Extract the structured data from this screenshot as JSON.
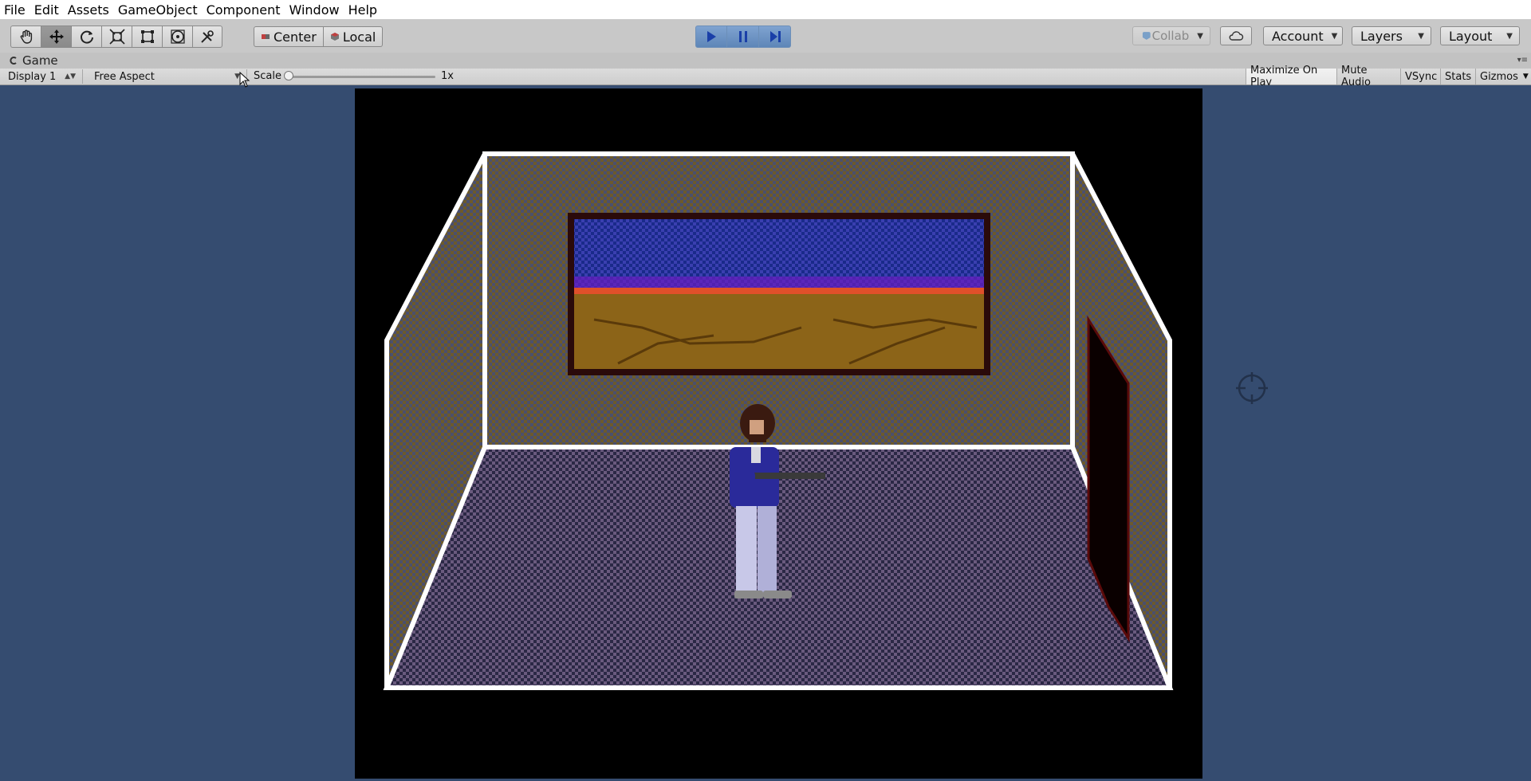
{
  "menu": [
    "File",
    "Edit",
    "Assets",
    "GameObject",
    "Component",
    "Window",
    "Help"
  ],
  "toolbar": {
    "tools": [
      {
        "name": "hand-tool",
        "icon": "hand-icon"
      },
      {
        "name": "move-tool",
        "icon": "move-icon",
        "active": true
      },
      {
        "name": "rotate-tool",
        "icon": "rotate-icon"
      },
      {
        "name": "scale-tool",
        "icon": "scale-icon"
      },
      {
        "name": "rect-tool",
        "icon": "rect-icon"
      },
      {
        "name": "transform-tool",
        "icon": "transform-icon"
      },
      {
        "name": "custom-tool",
        "icon": "tools-icon"
      }
    ],
    "pivot_label": "Center",
    "space_label": "Local",
    "collab_label": "Collab",
    "account_label": "Account",
    "layers_label": "Layers",
    "layout_label": "Layout"
  },
  "game_tab": {
    "label": "Game"
  },
  "gamebar": {
    "display": "Display 1",
    "aspect": "Free Aspect",
    "scale_label": "Scale",
    "scale_value": "1x",
    "scale_fraction": 0.0,
    "toggles": [
      {
        "label": "Maximize On Play",
        "on": true
      },
      {
        "label": "Mute Audio",
        "on": false
      },
      {
        "label": "VSync",
        "on": false
      },
      {
        "label": "Stats",
        "on": false
      },
      {
        "label": "Gizmos",
        "on": false
      }
    ]
  },
  "colors": {
    "viewport_bg": "#354c70",
    "play_accent": "#5e86b8",
    "wall_brown": "#6d5a2a",
    "sky_purple": "#3a2ca0"
  },
  "scene": {
    "description_icon": "character-sprite",
    "crosshair_icon": "crosshair-icon"
  }
}
